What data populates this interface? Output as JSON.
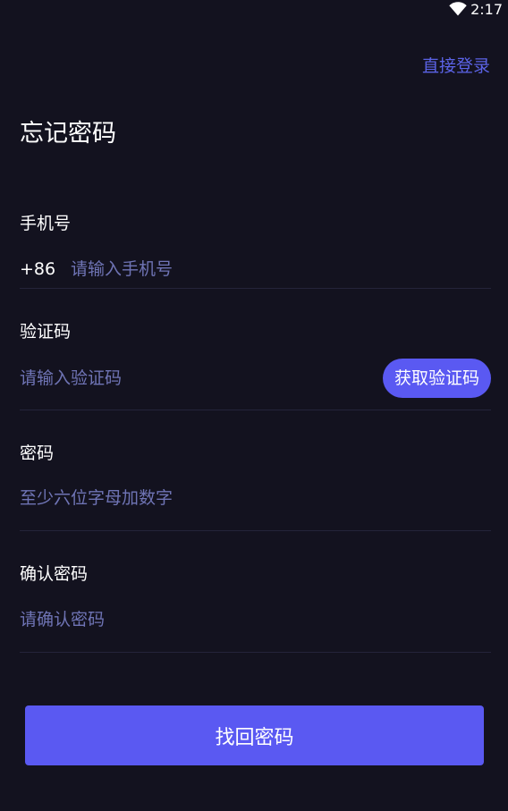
{
  "status_bar": {
    "time": "2:17",
    "wifi_icon": "wifi-icon"
  },
  "header": {
    "direct_login_label": "直接登录",
    "title": "忘记密码"
  },
  "form": {
    "phone": {
      "label": "手机号",
      "country_code": "+86",
      "placeholder": "请输入手机号",
      "value": ""
    },
    "code": {
      "label": "验证码",
      "placeholder": "请输入验证码",
      "value": "",
      "get_code_label": "获取验证码"
    },
    "password": {
      "label": "密码",
      "placeholder": "至少六位字母加数字",
      "value": ""
    },
    "confirm_password": {
      "label": "确认密码",
      "placeholder": "请确认密码",
      "value": ""
    }
  },
  "submit": {
    "label": "找回密码"
  },
  "colors": {
    "background": "#13121f",
    "accent": "#5a59f2",
    "link": "#5b63e6",
    "placeholder": "#6f74b5",
    "divider": "#24243a"
  }
}
